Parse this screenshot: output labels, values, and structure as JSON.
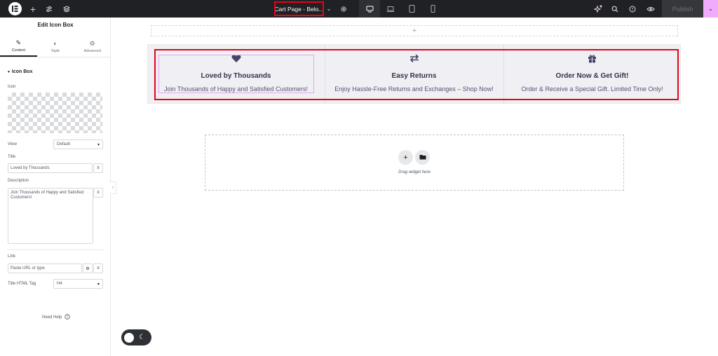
{
  "topbar": {
    "document_title": "Cart Page - Belo...",
    "publish_label": "Publish",
    "icons": [
      "elementor-logo-icon",
      "plus-icon",
      "sliders-icon",
      "layers-icon",
      "chevron-down-icon",
      "gear-icon",
      "desktop-icon",
      "laptop-icon",
      "tablet-icon",
      "mobile-icon",
      "sparkles-icon",
      "search-icon",
      "help-icon",
      "eye-icon"
    ]
  },
  "panel": {
    "title": "Edit Icon Box",
    "tabs": [
      {
        "label": "Content",
        "icon": "pencil-icon",
        "active": true
      },
      {
        "label": "Style",
        "icon": "half-circle-icon",
        "active": false
      },
      {
        "label": "Advanced",
        "icon": "gear-icon",
        "active": false
      }
    ],
    "section_title": "Icon Box",
    "icon_label": "Icon",
    "view_label": "View",
    "view_value": "Default",
    "title_label": "Title",
    "title_value": "Loved by Thousands",
    "description_label": "Description",
    "description_value": "Join Thousands of Happy and Satisfied Customers!",
    "link_label": "Link",
    "link_placeholder": "Paste URL or type",
    "html_tag_label": "Title HTML Tag",
    "html_tag_value": "H4",
    "need_help": "Need Help"
  },
  "canvas": {
    "boxes": [
      {
        "icon": "heart-icon",
        "title": "Loved by Thousands",
        "description": "Join Thousands of Happy and Satisfied Customers!"
      },
      {
        "icon": "exchange-arrows-icon",
        "title": "Easy Returns",
        "description": "Enjoy Hassle-Free Returns and Exchanges – Shop Now!"
      },
      {
        "icon": "gift-icon",
        "title": "Order Now & Get Gift!",
        "description": "Order & Receive a Special Gift. Limited Time Only!"
      }
    ],
    "drop_text": "Drag widget here"
  },
  "colors": {
    "topbar_bg": "#1f2124",
    "highlight_red": "#e2051b",
    "section_bg": "#f0f0f4",
    "publish_accent": "#f0abfc",
    "icon_color": "#45456b"
  }
}
